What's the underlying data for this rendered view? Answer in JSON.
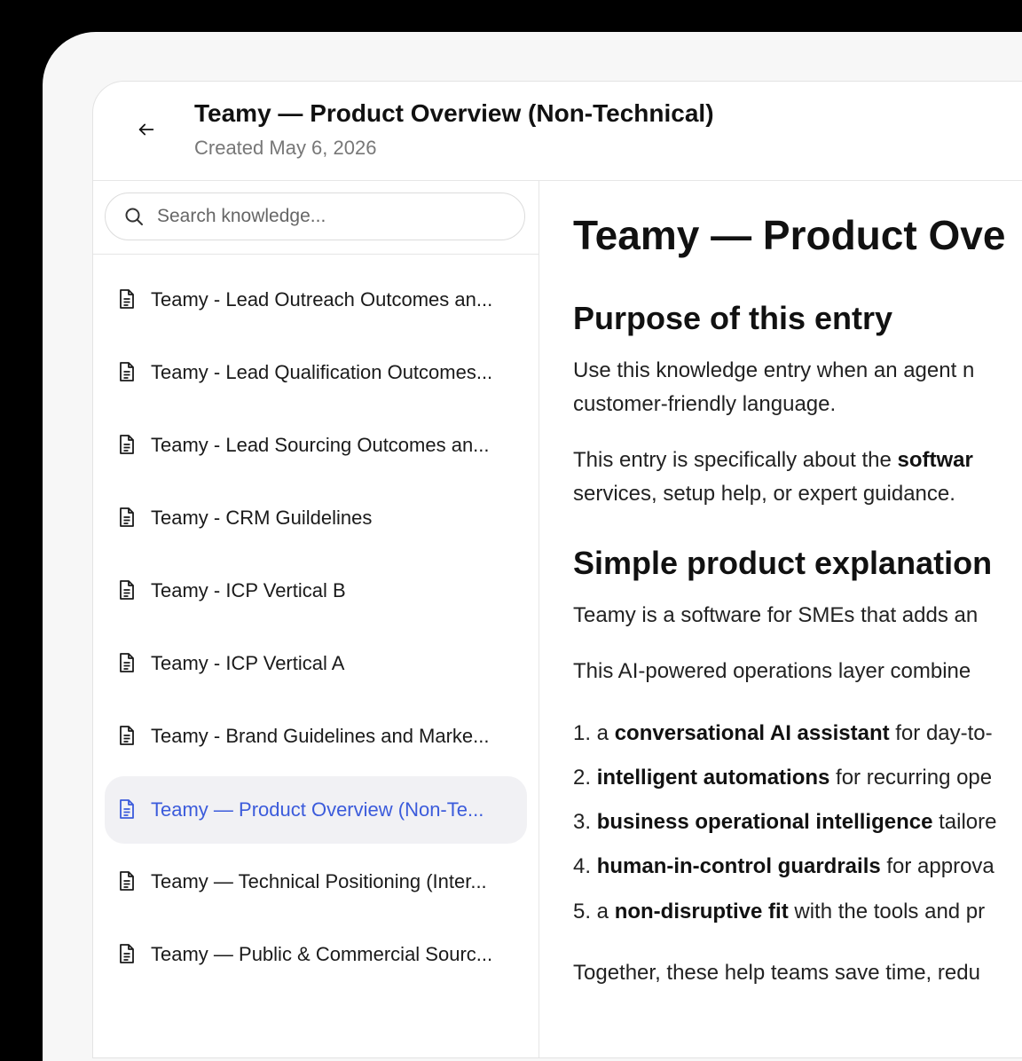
{
  "header": {
    "title": "Teamy — Product Overview (Non-Technical)",
    "created": "Created May 6, 2026"
  },
  "search": {
    "placeholder": "Search knowledge..."
  },
  "sidebar": {
    "items": [
      {
        "label": "Teamy - Lead Outreach Outcomes an..."
      },
      {
        "label": "Teamy - Lead Qualification Outcomes..."
      },
      {
        "label": "Teamy - Lead Sourcing Outcomes an..."
      },
      {
        "label": "Teamy - CRM Guildelines"
      },
      {
        "label": "Teamy - ICP Vertical B"
      },
      {
        "label": "Teamy - ICP Vertical A"
      },
      {
        "label": "Teamy - Brand Guidelines and Marke..."
      },
      {
        "label": "Teamy — Product Overview (Non-Te...",
        "active": true
      },
      {
        "label": "Teamy — Technical Positioning (Inter..."
      },
      {
        "label": "Teamy — Public & Commercial Sourc..."
      }
    ]
  },
  "content": {
    "title": "Teamy — Product Ove",
    "section1": {
      "heading": "Purpose of this entry",
      "p1_line1": "Use this knowledge entry when an agent n",
      "p1_line2": "customer-friendly language.",
      "p2_line1_pre": "This entry is specifically about the ",
      "p2_line1_bold": "softwar",
      "p2_line2": "services, setup help, or expert guidance."
    },
    "section2": {
      "heading": "Simple product explanation",
      "p1": "Teamy is a software for SMEs that adds an",
      "p2": "This AI-powered operations layer combine",
      "list": [
        {
          "num": "1. a ",
          "bold": "conversational AI assistant",
          "rest": " for day-to-"
        },
        {
          "num": "2. ",
          "bold": "intelligent automations",
          "rest": " for recurring ope"
        },
        {
          "num": "3. ",
          "bold": "business operational intelligence",
          "rest": " tailore"
        },
        {
          "num": "4. ",
          "bold": "human-in-control guardrails",
          "rest": " for approva"
        },
        {
          "num": "5. a ",
          "bold": "non-disruptive fit",
          "rest": " with the tools and pr"
        }
      ],
      "closing": "Together, these help teams save time, redu"
    }
  },
  "colors": {
    "accent": "#3b5bdb",
    "active_bg": "#f1f1f4"
  }
}
